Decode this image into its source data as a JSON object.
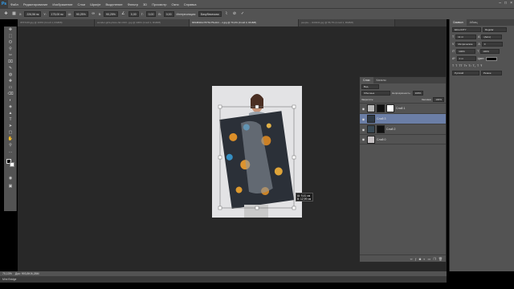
{
  "app": {
    "logo": "Ps"
  },
  "menubar": {
    "items": [
      "Файл",
      "Редактирование",
      "Изображение",
      "Слои",
      "Шрифт",
      "Выделение",
      "Фильтр",
      "3D",
      "Просмотр",
      "Окно",
      "Справка"
    ],
    "window_controls": [
      "–",
      "□",
      "×"
    ]
  },
  "options": {
    "x_label": "X:",
    "x_value": "226,56 пк",
    "y_label": "Y:",
    "y_value": "175,00 пк",
    "w_label": "Ш:",
    "w_value": "90,25%",
    "h_label": "В:",
    "h_value": "90,25%",
    "angle_value": "0,00",
    "h_skew_label": "Г:",
    "h_skew_value": "0,00",
    "v_skew_label": "В:",
    "v_skew_value": "0,00",
    "interp_label": "Интерполяция:",
    "interp_value": "Бикубическая",
    "cancel_icon": "cancel-icon",
    "commit_icon": "commit-icon"
  },
  "tabs": [
    {
      "label": "ЗТЗ7215.jpg @ 100% (Слой 1, RGB/8)",
      "active": false
    },
    {
      "label": "wonder-girls-photo-hd-1013...jpg @ 100% (Слой 1, RGB/8)",
      "active": false
    },
    {
      "label": "8494841bc767f1c75e3c2...-1.jpg @ 70,4% (Слой 3, RGB/8)",
      "active": true
    },
    {
      "label": "people-...-940441.jpg @ 56,7% (Слой 1, RGB/8)",
      "active": false
    }
  ],
  "tools": [
    "✥",
    "⬚",
    "ʘ",
    "⚲",
    "✂",
    "⌧",
    "✎",
    "◍",
    "✚",
    "▭",
    "⌫",
    "◐",
    "◈",
    "▲",
    "T",
    "➤",
    "▢",
    "✋",
    "⚲",
    "…"
  ],
  "layers_panel": {
    "tabs": [
      "Слои",
      "Каналы"
    ],
    "kind_label": "Вид",
    "blend_mode": "Обычные",
    "opacity_label": "Непрозрачность:",
    "opacity_value": "100%",
    "lock_label": "Закрепить:",
    "fill_label": "Заливка:",
    "fill_value": "100%",
    "layers": [
      {
        "name": "Слой 1",
        "selected": false
      },
      {
        "name": "Слой 3",
        "selected": true
      },
      {
        "name": "Слой 2",
        "selected": false
      },
      {
        "name": "Слой 0",
        "selected": false
      }
    ],
    "footer_icons": [
      "link-icon",
      "fx-icon",
      "mask-icon",
      "adjustment-icon",
      "folder-icon",
      "new-layer-icon",
      "trash-icon"
    ]
  },
  "right_panel": {
    "tabs": [
      "Символ",
      "Абзац"
    ],
    "font_family": "ElmerCITY",
    "font_style": "Regular",
    "size": "11 пт",
    "leading": "(Авто)",
    "kerning": "Метрические",
    "tracking": "0",
    "scale_v": "100%",
    "scale_h": "100%",
    "baseline": "0 пт",
    "color_label": "Цвет:",
    "language": "Русский",
    "aa": "Резкое"
  },
  "measure": {
    "w": "Ш: 9,41 см",
    "h": "В: 12,99 см"
  },
  "status": {
    "zoom": "70,13%",
    "doc": "Док: 993,8K/6,28M"
  },
  "minibridge": {
    "label": "Mini Bridge"
  }
}
